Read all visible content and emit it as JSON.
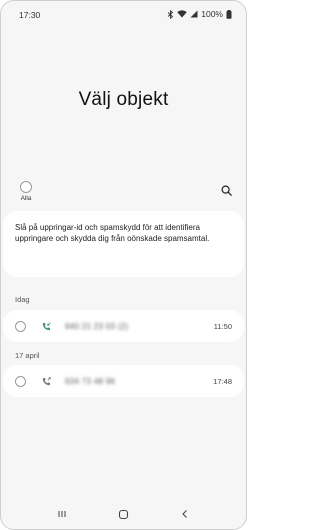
{
  "status_bar": {
    "time": "17:30",
    "battery": "100%"
  },
  "title": "Välj objekt",
  "select_all": {
    "label": "Alla"
  },
  "info_card": {
    "text": "Slå på uppringar-id och spamskydd för att identifiera uppringare och skydda dig från oönskade spamsamtal."
  },
  "sections": [
    {
      "header": "Idag",
      "entries": [
        {
          "number": "940 21 23 03 (2)",
          "time": "11:50"
        }
      ]
    },
    {
      "header": "17 april",
      "entries": [
        {
          "number": "634 73 48 96",
          "time": "17:48"
        }
      ]
    }
  ],
  "nav": {
    "recents": "recents-icon",
    "home": "home-icon",
    "back": "back-icon"
  },
  "colors": {
    "background": "#f6f6f6",
    "card": "#ffffff",
    "text": "#111111"
  }
}
